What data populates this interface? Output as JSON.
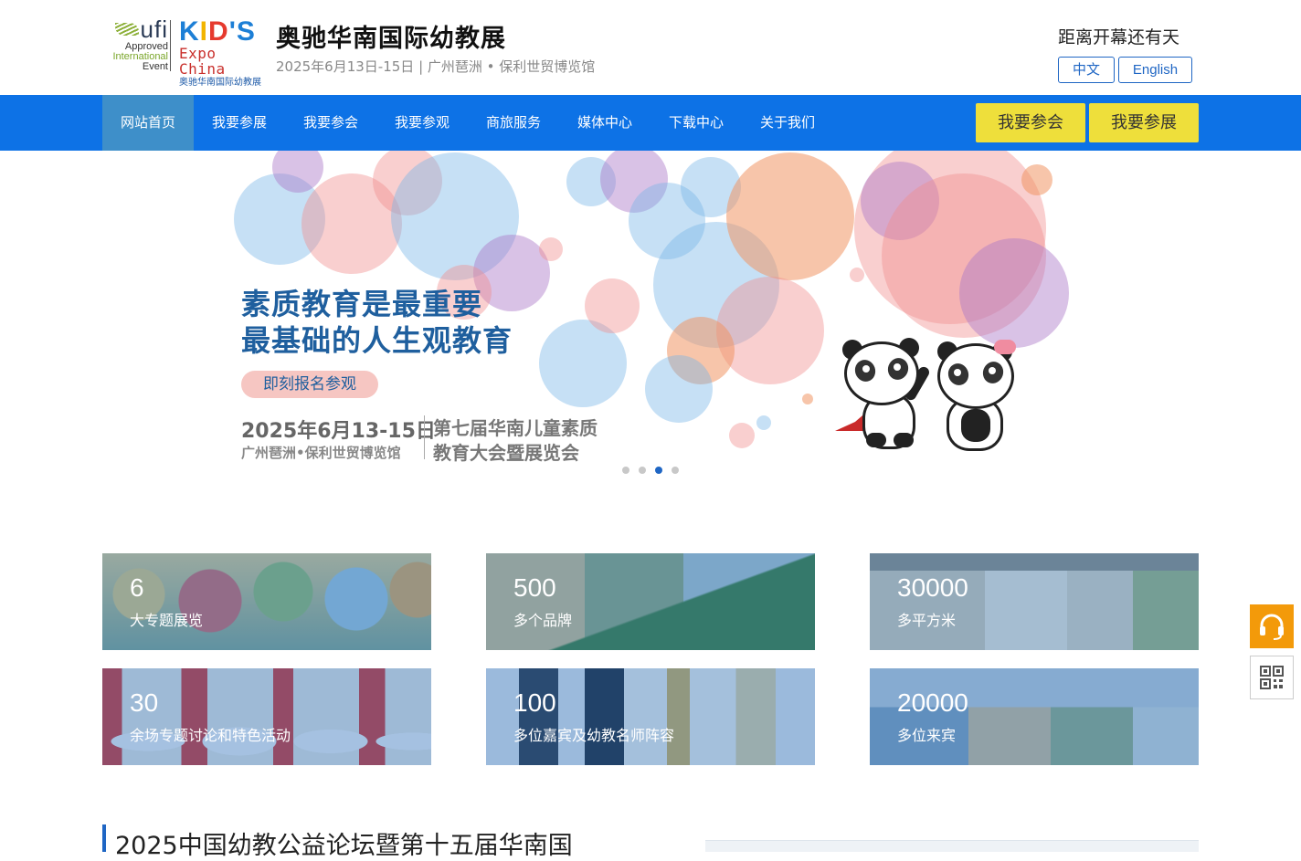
{
  "header": {
    "ufi": {
      "mark": "ufi",
      "line1": "Approved",
      "line2": "International",
      "line3": "Event"
    },
    "kids_logo": {
      "word": [
        "K",
        "I",
        "D",
        "'",
        "S"
      ],
      "sub": "Expo China",
      "cn": "奥驰华南国际幼教展"
    },
    "title": "奥驰华南国际幼教展",
    "subtitle": "2025年6月13日-15日 | 广州琶洲 • 保利世贸博览馆",
    "countdown": "距离开幕还有天",
    "lang_cn": "中文",
    "lang_en": "English"
  },
  "nav": {
    "items": [
      "网站首页",
      "我要参展",
      "我要参会",
      "我要参观",
      "商旅服务",
      "媒体中心",
      "下载中心",
      "关于我们"
    ],
    "active_index": 0,
    "cta_attend": "我要参会",
    "cta_exhibit": "我要参展"
  },
  "banner": {
    "headline1": "素质教育是最重要",
    "headline2": "最基础的人生观教育",
    "button": "即刻报名参观",
    "date": "2025年6月13-15日",
    "venue": "广州琶洲•保利世贸博览馆",
    "event1": "第七届华南儿童素质",
    "event2": "教育大会暨展览会",
    "slide_count": 4,
    "active_slide": 2
  },
  "stats": [
    {
      "num": "6",
      "label": "大专题展览"
    },
    {
      "num": "500",
      "label": "多个品牌"
    },
    {
      "num": "30000",
      "label": "多平方米"
    },
    {
      "num": "30",
      "label": "余场专题讨论和特色活动"
    },
    {
      "num": "100",
      "label": "多位嘉宾及幼教名师阵容"
    },
    {
      "num": "20000",
      "label": "多位来宾"
    }
  ],
  "side": {
    "service_icon": "headset-icon",
    "qr_icon": "qr-code-icon"
  },
  "news": {
    "title": "2025中国幼教公益论坛暨第十五届华南国"
  },
  "colors": {
    "nav_bg": "#0d72e6",
    "nav_active": "#3e8fc9",
    "cta_yellow": "#eedf3b",
    "brand_blue": "#1f66c4",
    "service_orange": "#f39a0a"
  }
}
